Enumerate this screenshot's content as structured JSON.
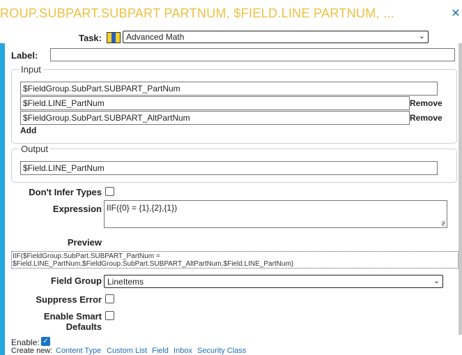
{
  "header": {
    "title": "ROUP.SUBPART.SUBPART  PARTNUM, $FIELD.LINE  PARTNUM, ...",
    "close_icon": "✕"
  },
  "task": {
    "label": "Task:",
    "icon": "task-type-icon",
    "selected": "Advanced Math"
  },
  "label_field": {
    "label": "Label:",
    "value": ""
  },
  "input_group": {
    "legend": "Input",
    "fields": [
      "$FieldGroup.SubPart.SUBPART_PartNum",
      "$Field.LINE_PartNum",
      "$FieldGroup.SubPart.SUBPART_AltPartNum"
    ],
    "remove_label": "Remove",
    "add_label": "Add"
  },
  "output_group": {
    "legend": "Output",
    "field": "$Field.LINE_PartNum"
  },
  "dont_infer": {
    "label": "Don't Infer Types",
    "checked": false
  },
  "expression": {
    "label": "Expression",
    "value": "IIF({0} = {1},{2},{1})"
  },
  "preview": {
    "label": "Preview",
    "line1": "IIF($FieldGroup.SubPart.SUBPART_PartNum =",
    "line2": "$Field.LINE_PartNum,$FieldGroup.SubPart.SUBPART_AltPartNum,$Field.LINE_PartNum)"
  },
  "field_group": {
    "label": "Field Group",
    "selected": "LineItems"
  },
  "suppress_error": {
    "label": "Suppress Error",
    "checked": false
  },
  "smart_defaults": {
    "label_line1": "Enable Smart",
    "label_line2": "Defaults",
    "checked": false
  },
  "footer": {
    "enable_label": "Enable:",
    "enable_checked": true,
    "create_new_label": "Create new:",
    "links": [
      "Content Type",
      "Custom List",
      "Field",
      "Inbox",
      "Security Class"
    ]
  },
  "colors": {
    "title": "#f0c040",
    "accent_blue": "#22a7de",
    "link": "#1e6fb5"
  }
}
